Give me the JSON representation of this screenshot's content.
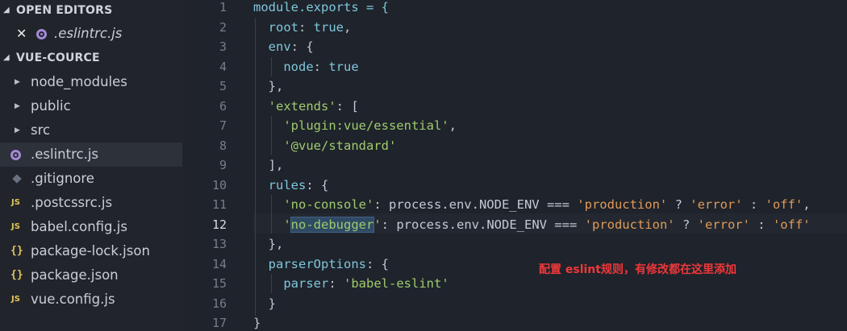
{
  "sidebar": {
    "open_editors_header": "OPEN EDITORS",
    "open_editors": [
      {
        "name": ".eslintrc.js",
        "icon": "eslint-gear-icon"
      }
    ],
    "project_header": "VUE-COURCE",
    "items": [
      {
        "name": "node_modules",
        "type": "folder"
      },
      {
        "name": "public",
        "type": "folder"
      },
      {
        "name": "src",
        "type": "folder"
      },
      {
        "name": ".eslintrc.js",
        "type": "eslint",
        "selected": true
      },
      {
        "name": ".gitignore",
        "type": "git"
      },
      {
        "name": ".postcssrc.js",
        "type": "js"
      },
      {
        "name": "babel.config.js",
        "type": "js"
      },
      {
        "name": "package-lock.json",
        "type": "json"
      },
      {
        "name": "package.json",
        "type": "json"
      },
      {
        "name": "vue.config.js",
        "type": "js"
      }
    ],
    "js_icon_text": "JS",
    "json_icon_text": "{}"
  },
  "editor": {
    "line_numbers": [
      "1",
      "2",
      "3",
      "4",
      "5",
      "6",
      "7",
      "8",
      "9",
      "10",
      "11",
      "12",
      "13",
      "14",
      "15",
      "16",
      "17"
    ],
    "active_line": 12,
    "lines": {
      "l1": "module.exports = {",
      "l2_key": "root",
      "l2_val": "true",
      "l3_key": "env",
      "l4_key": "node",
      "l4_val": "true",
      "l5": "},",
      "l6_key": "'extends'",
      "l7_val": "'plugin:vue/essential'",
      "l8_val": "'@vue/standard'",
      "l9": "],",
      "l10_key": "rules",
      "l11_key": "'no-console'",
      "l11_expr": "process.env.NODE_ENV === ",
      "l11_prod": "'production'",
      "l11_error": "'error'",
      "l11_off": "'off'",
      "l12_q1": "'",
      "l12_key_sel": "no-debugger",
      "l12_q2": "'",
      "l12_expr": "process.env.NODE_ENV === ",
      "l12_prod": "'production'",
      "l12_error": "'error'",
      "l12_off": "'off'",
      "l13": "},",
      "l14_key": "parserOptions",
      "l15_key": "parser",
      "l15_val": "'babel-eslint'",
      "l16": "}",
      "l17": "}"
    }
  },
  "annotation": "配置 eslint规则，有修改都在这里添加"
}
